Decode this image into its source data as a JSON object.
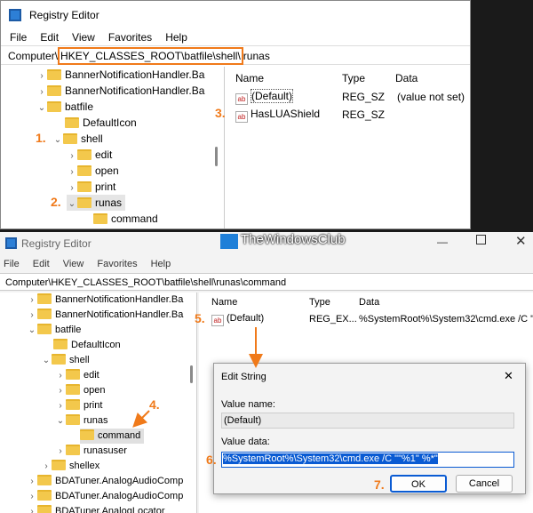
{
  "top": {
    "title": "Registry Editor",
    "menu": [
      "File",
      "Edit",
      "View",
      "Favorites",
      "Help"
    ],
    "address": {
      "prefix": "Computer\\",
      "highlight": "HKEY_CLASSES_ROOT\\batfile\\shell\\",
      "suffix": "runas"
    },
    "tree": [
      "BannerNotificationHandler.Ba",
      "BannerNotificationHandler.Ba",
      "batfile",
      "DefaultIcon",
      "shell",
      "edit",
      "open",
      "print",
      "runas",
      "command"
    ],
    "headers": [
      "Name",
      "Type",
      "Data"
    ],
    "values": [
      {
        "name": "(Default)",
        "type": "REG_SZ",
        "data": "(value not set)"
      },
      {
        "name": "HasLUAShield",
        "type": "REG_SZ",
        "data": ""
      }
    ]
  },
  "bottom": {
    "title": "Registry Editor",
    "watermark": "TheWindowsClub",
    "menu": [
      "File",
      "Edit",
      "View",
      "Favorites",
      "Help"
    ],
    "address": "Computer\\HKEY_CLASSES_ROOT\\batfile\\shell\\runas\\command",
    "tree": [
      "BannerNotificationHandler.Ba",
      "BannerNotificationHandler.Ba",
      "batfile",
      "DefaultIcon",
      "shell",
      "edit",
      "open",
      "print",
      "runas",
      "command",
      "runasuser",
      "shellex",
      "BDATuner.AnalogAudioComp",
      "BDATuner.AnalogAudioComp",
      "BDATuner.AnalogLocator"
    ],
    "headers": [
      "Name",
      "Type",
      "Data"
    ],
    "values": [
      {
        "name": "(Default)",
        "type": "REG_EX...",
        "data": "%SystemRoot%\\System32\\cmd.exe /C \""
      }
    ],
    "dialog": {
      "title": "Edit String",
      "name_label": "Value name:",
      "name_value": "(Default)",
      "data_label": "Value data:",
      "data_value": "%SystemRoot%\\System32\\cmd.exe /C \"\"%1\" %*\"",
      "ok": "OK",
      "cancel": "Cancel"
    }
  },
  "steps": [
    "1.",
    "2.",
    "3.",
    "4.",
    "5.",
    "6.",
    "7."
  ],
  "colors": {
    "accent": "#f07a1a",
    "selection": "#0a5bd3"
  }
}
